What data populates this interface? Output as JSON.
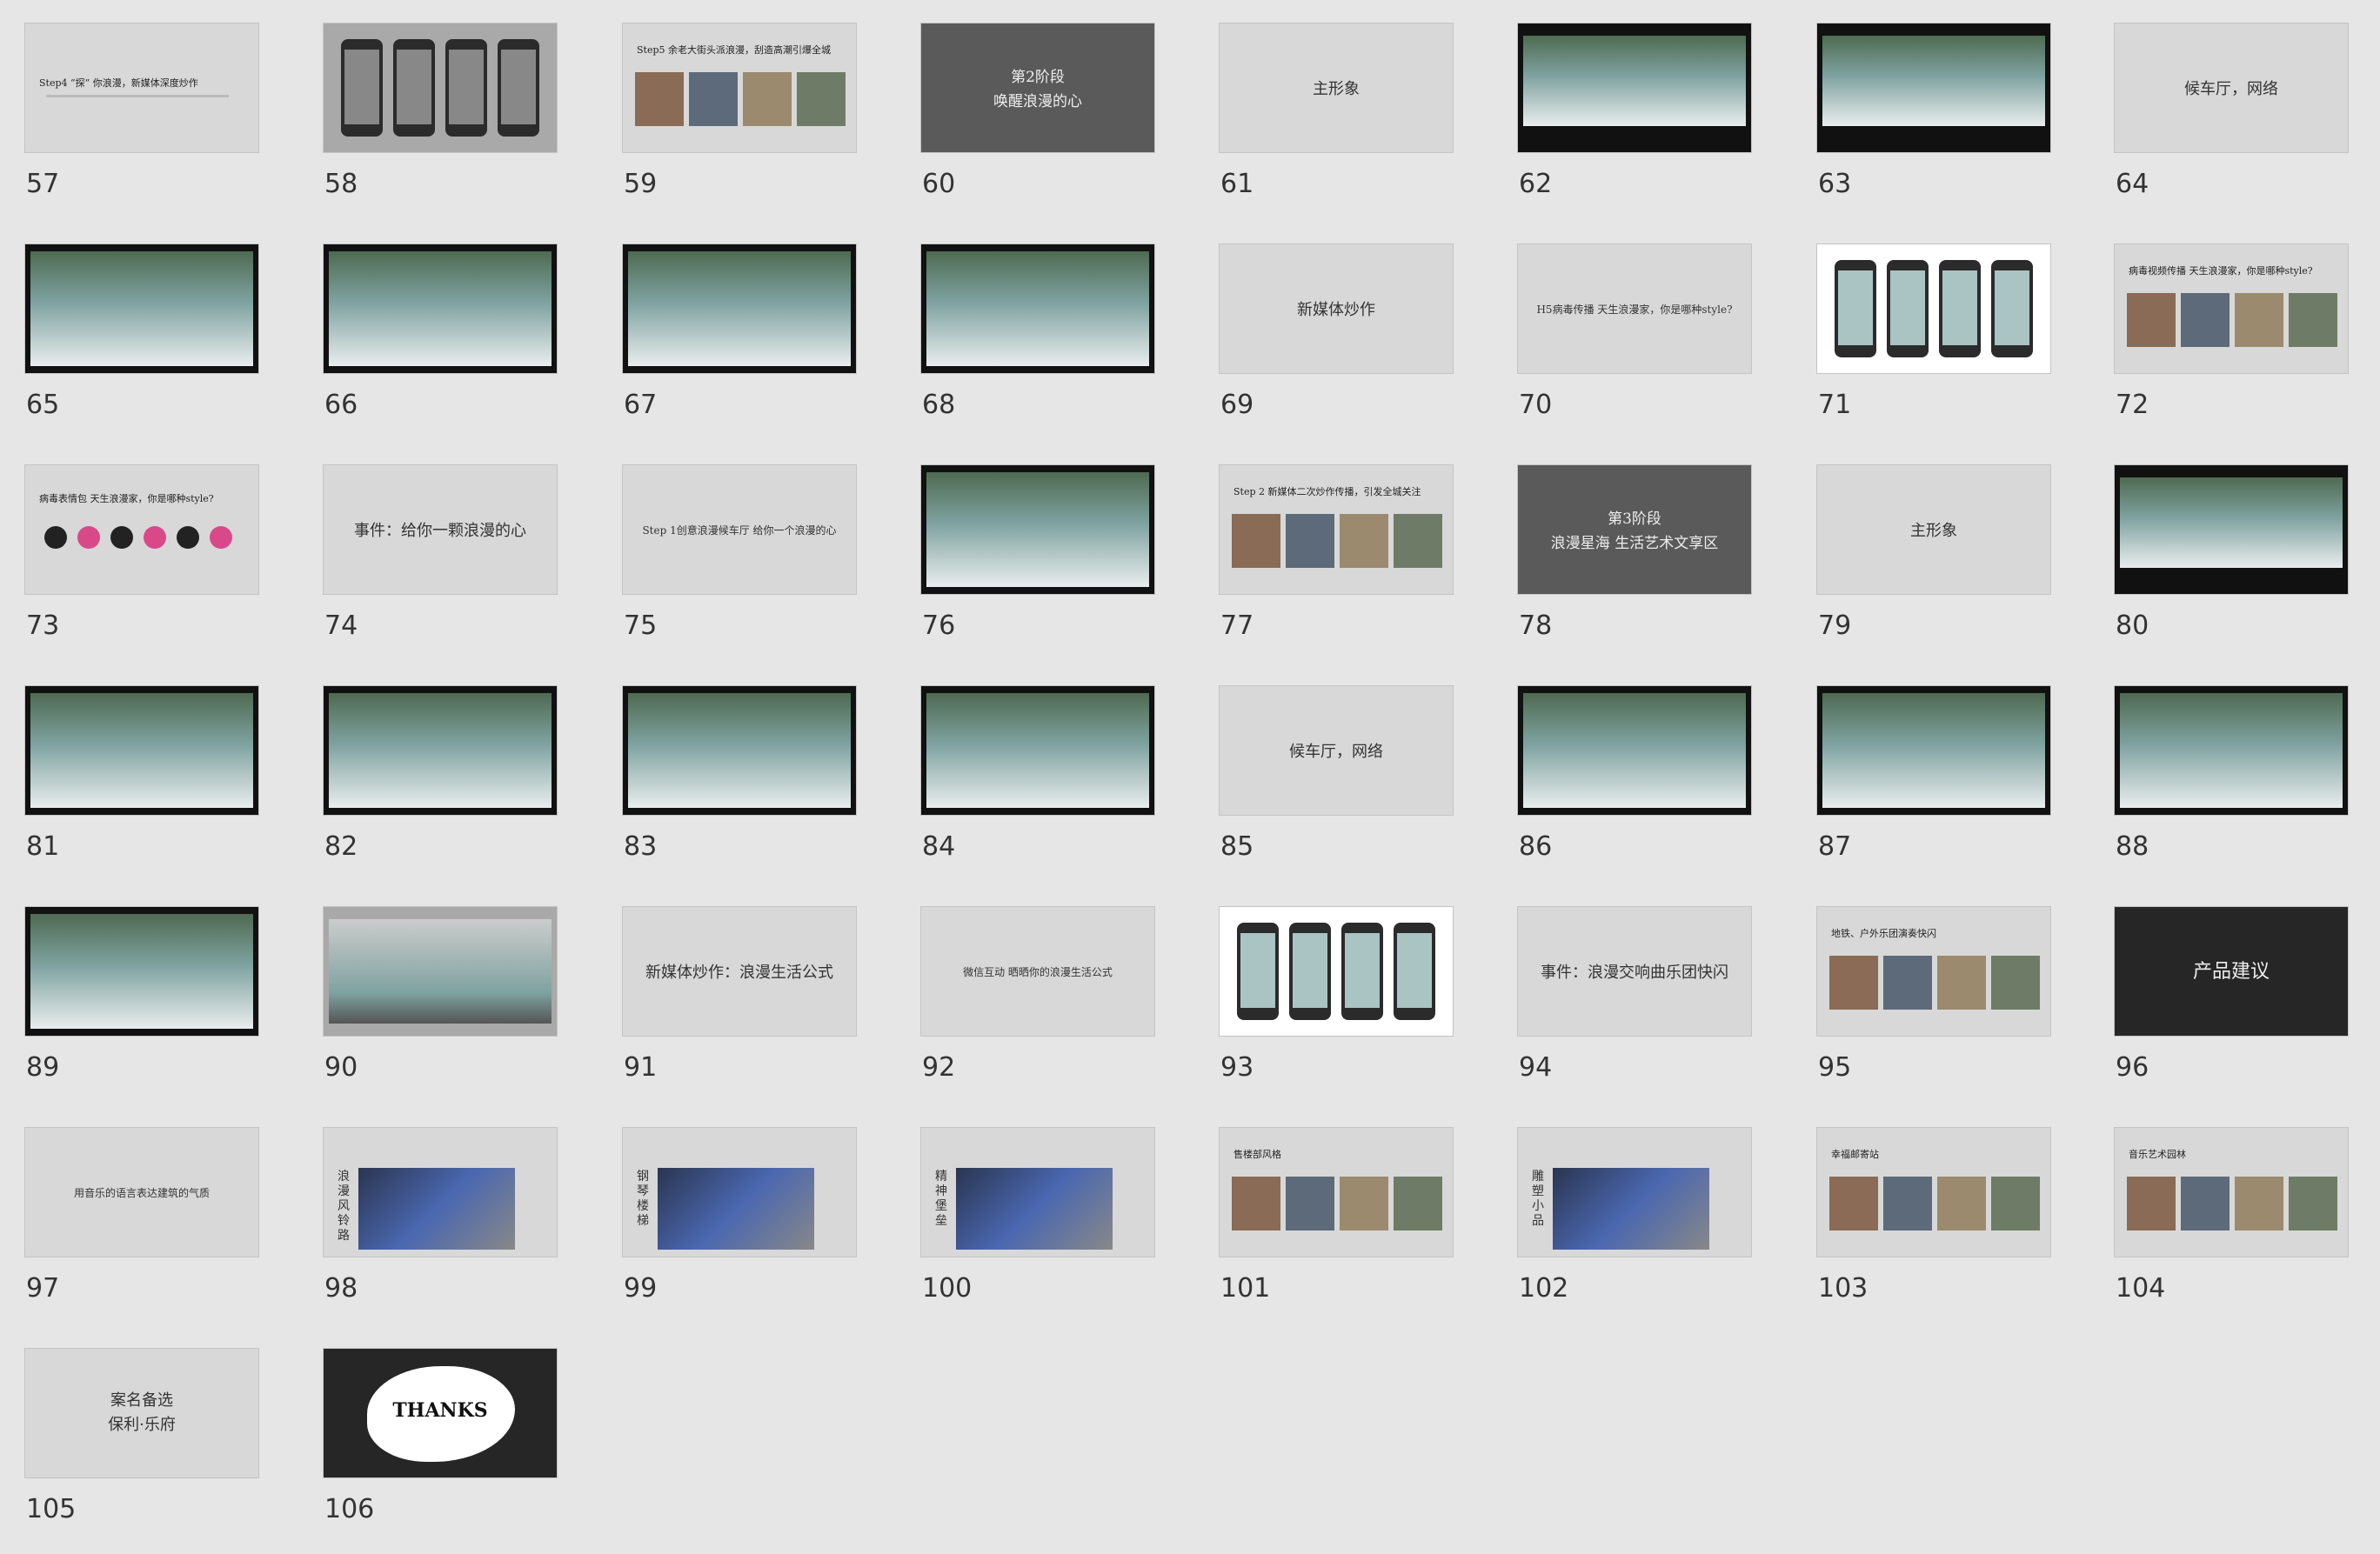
{
  "slides": [
    {
      "num": "57",
      "caption": "Step4 “探” 你浪漫，新媒体深度炒作",
      "kind": "textleft"
    },
    {
      "num": "58",
      "caption": "",
      "kind": "phones-gray"
    },
    {
      "num": "59",
      "caption": "Step5 余老大街头派浪漫，刮造高潮引爆全城",
      "kind": "photos"
    },
    {
      "num": "60",
      "caption": "第2阶段\n唤醒浪漫的心",
      "kind": "dark"
    },
    {
      "num": "61",
      "caption": "主形象",
      "kind": "plain"
    },
    {
      "num": "62",
      "caption": "",
      "kind": "black-banner"
    },
    {
      "num": "63",
      "caption": "",
      "kind": "black-banner"
    },
    {
      "num": "64",
      "caption": "候车厅，网络",
      "kind": "plain"
    },
    {
      "num": "65",
      "caption": "",
      "kind": "black-photo"
    },
    {
      "num": "66",
      "caption": "",
      "kind": "black-photo"
    },
    {
      "num": "67",
      "caption": "",
      "kind": "black-photo"
    },
    {
      "num": "68",
      "caption": "",
      "kind": "black-photo"
    },
    {
      "num": "69",
      "caption": "新媒体炒作",
      "kind": "plain"
    },
    {
      "num": "70",
      "caption": "H5病毒传播 天生浪漫家，你是哪种style?",
      "kind": "plain-small"
    },
    {
      "num": "71",
      "caption": "",
      "kind": "phones-white"
    },
    {
      "num": "72",
      "caption": "病毒视频传播 天生浪漫家，你是哪种style?",
      "kind": "photos"
    },
    {
      "num": "73",
      "caption": "病毒表情包 天生浪漫家，你是哪种style?",
      "kind": "emoji"
    },
    {
      "num": "74",
      "caption": "事件：给你一颗浪漫的心",
      "kind": "plain"
    },
    {
      "num": "75",
      "caption": "Step 1创意浪漫候车厅 给你一个浪漫的心",
      "kind": "plain-small"
    },
    {
      "num": "76",
      "caption": "",
      "kind": "black-photo"
    },
    {
      "num": "77",
      "caption": "Step 2 新媒体二次炒作传播，引发全城关注",
      "kind": "photos"
    },
    {
      "num": "78",
      "caption": "第3阶段\n浪漫星海 生活艺术文享区",
      "kind": "dark"
    },
    {
      "num": "79",
      "caption": "主形象",
      "kind": "plain"
    },
    {
      "num": "80",
      "caption": "",
      "kind": "black-banner"
    },
    {
      "num": "81",
      "caption": "",
      "kind": "black-photo"
    },
    {
      "num": "82",
      "caption": "",
      "kind": "black-photo"
    },
    {
      "num": "83",
      "caption": "",
      "kind": "black-photo"
    },
    {
      "num": "84",
      "caption": "",
      "kind": "black-photo"
    },
    {
      "num": "85",
      "caption": "候车厅，网络",
      "kind": "plain"
    },
    {
      "num": "86",
      "caption": "",
      "kind": "black-photo"
    },
    {
      "num": "87",
      "caption": "",
      "kind": "black-photo"
    },
    {
      "num": "88",
      "caption": "",
      "kind": "black-photo"
    },
    {
      "num": "89",
      "caption": "",
      "kind": "black-photo"
    },
    {
      "num": "90",
      "caption": "",
      "kind": "gray-photo"
    },
    {
      "num": "91",
      "caption": "新媒体炒作：浪漫生活公式",
      "kind": "plain"
    },
    {
      "num": "92",
      "caption": "微信互动 晒晒你的浪漫生活公式",
      "kind": "plain-small"
    },
    {
      "num": "93",
      "caption": "",
      "kind": "phones-white"
    },
    {
      "num": "94",
      "caption": "事件：浪漫交响曲乐团快闪",
      "kind": "plain"
    },
    {
      "num": "95",
      "caption": "地铁、户外乐团演奏快闪",
      "kind": "photos"
    },
    {
      "num": "96",
      "caption": "产品建议",
      "kind": "blk2"
    },
    {
      "num": "97",
      "caption": "用音乐的语言表达建筑的气质",
      "kind": "plain-small"
    },
    {
      "num": "98",
      "caption": "浪漫风铃路",
      "kind": "vert"
    },
    {
      "num": "99",
      "caption": "钢琴楼梯",
      "kind": "vert"
    },
    {
      "num": "100",
      "caption": "精神堡垒",
      "kind": "vert"
    },
    {
      "num": "101",
      "caption": "售楼部风格",
      "kind": "photos"
    },
    {
      "num": "102",
      "caption": "雕塑小品",
      "kind": "vert"
    },
    {
      "num": "103",
      "caption": "幸福邮寄站",
      "kind": "photos"
    },
    {
      "num": "104",
      "caption": "音乐艺术园林",
      "kind": "photos"
    },
    {
      "num": "105",
      "caption": "案名备选\n保利·乐府",
      "kind": "plain"
    },
    {
      "num": "106",
      "caption": "THANKS",
      "kind": "thanks"
    }
  ],
  "colors": {
    "background": "#e6e6e6",
    "slide": "#d8d8d8",
    "dark": "#5a5a5a",
    "accent": "#7fa3a1"
  }
}
